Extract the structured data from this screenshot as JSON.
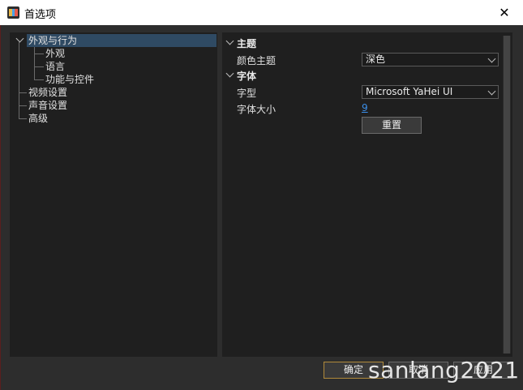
{
  "window": {
    "title": "首选项",
    "close_symbol": "✕"
  },
  "tree": {
    "items": [
      {
        "label": "外观与行为"
      },
      {
        "label": "外观"
      },
      {
        "label": "语言"
      },
      {
        "label": "功能与控件"
      },
      {
        "label": "视频设置"
      },
      {
        "label": "声音设置"
      },
      {
        "label": "高级"
      }
    ]
  },
  "settings": {
    "theme_section": "主题",
    "theme_color_label": "颜色主题",
    "theme_color_value": "深色",
    "font_section": "字体",
    "font_face_label": "字型",
    "font_face_value": "Microsoft YaHei UI",
    "font_size_label": "字体大小",
    "font_size_value": "9",
    "reset_label": "重置"
  },
  "footer": {
    "ok_label": "确定",
    "cancel_label": "取消",
    "apply_label": "应用"
  },
  "watermark": "sanlang2021",
  "colors": {
    "selection": "#2f4a63",
    "link": "#3b8ee8",
    "primary_border": "#b08a3a"
  }
}
